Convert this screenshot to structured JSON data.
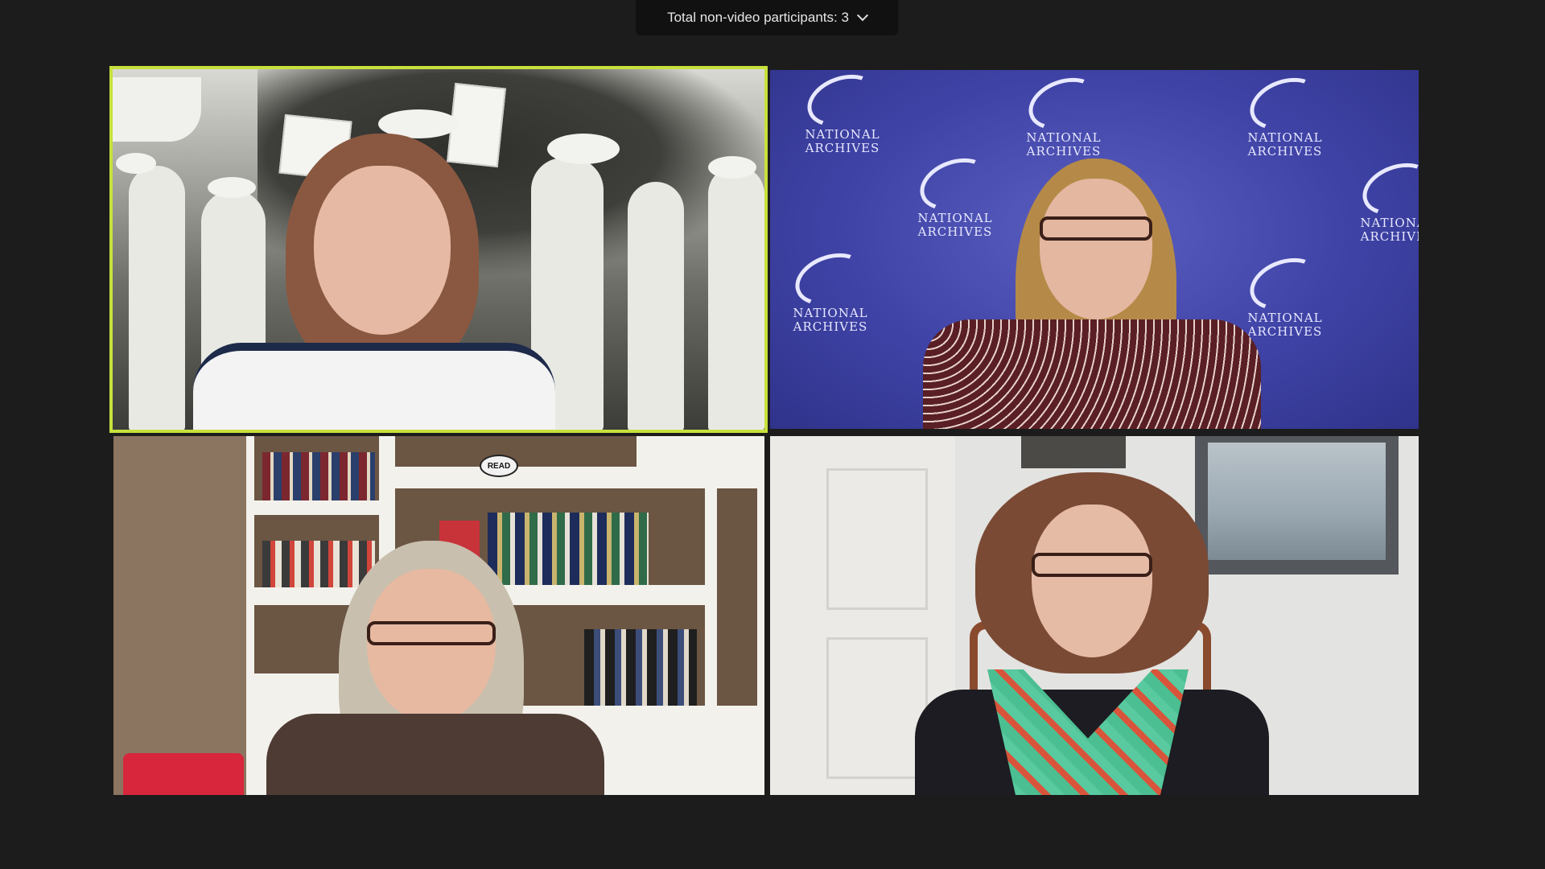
{
  "header": {
    "non_video_participants_label": "Total non-video participants: 3"
  },
  "tiles": [
    {
      "id": "tile-1",
      "active_speaker": true
    },
    {
      "id": "tile-2",
      "active_speaker": false,
      "backdrop_logo_lines": [
        "NATIONAL",
        "ARCHIVES"
      ]
    },
    {
      "id": "tile-3",
      "active_speaker": false,
      "sign_text": "READ"
    },
    {
      "id": "tile-4",
      "active_speaker": false
    }
  ],
  "colors": {
    "active_speaker_border": "#c8e03c",
    "background": "#1c1c1c",
    "archives_blue": "#3f43a6"
  },
  "icons": {
    "dropdown": "chevron-down-icon"
  }
}
